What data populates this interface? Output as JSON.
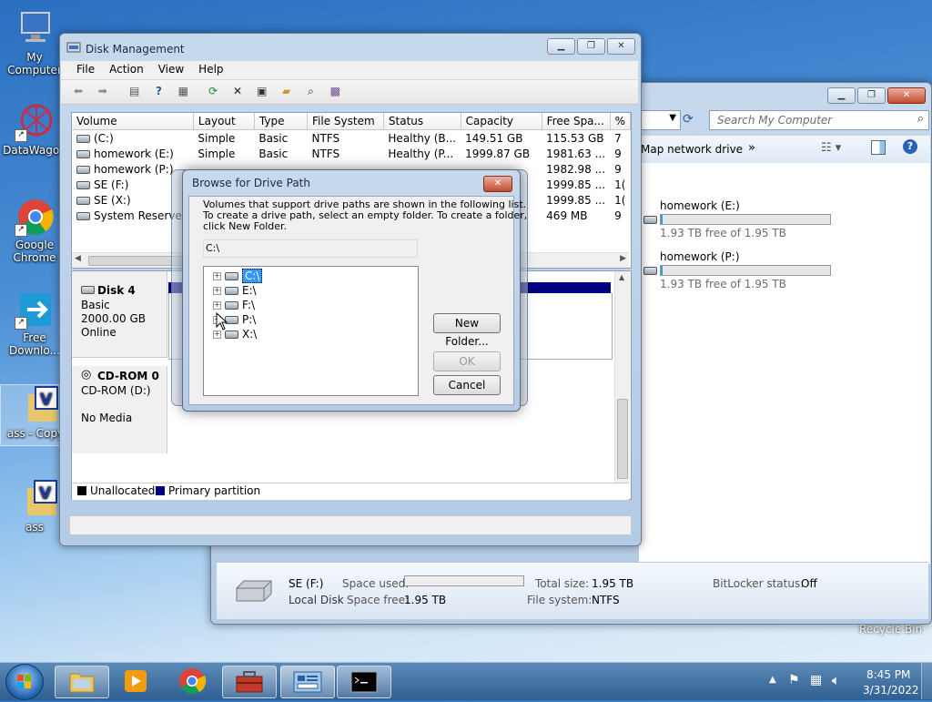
{
  "desktop": {
    "icons": [
      {
        "label": "My Computer",
        "glyph": "monitor-icon"
      },
      {
        "label": "DataWagon",
        "glyph": "datawagon-icon"
      },
      {
        "label": "Google Chrome",
        "glyph": "chrome-icon"
      },
      {
        "label": "Free Downlo...",
        "glyph": "download-icon"
      },
      {
        "label": "ass - Copy",
        "glyph": "folder-icon"
      },
      {
        "label": "ass",
        "glyph": "folder-icon"
      }
    ],
    "recycle_bin": "Recycle Bin"
  },
  "explorer": {
    "search_placeholder": "Search My Computer",
    "map_drive": "Map network drive",
    "more": "»",
    "drives": [
      {
        "name": "homework (E:)",
        "free": "1.93 TB free of 1.95 TB"
      },
      {
        "name": "homework (P:)",
        "free": "1.93 TB free of 1.95 TB"
      }
    ],
    "details": {
      "name": "SE (F:)",
      "type": "Local Disk",
      "space_used_label": "Space used:",
      "space_free_label": "Space free:",
      "space_free": "1.95 TB",
      "total_size_label": "Total size:",
      "total_size": "1.95 TB",
      "filesystem_label": "File system:",
      "filesystem": "NTFS",
      "bitlocker_label": "BitLocker status:",
      "bitlocker": "Off"
    }
  },
  "disk_mgmt": {
    "title": "Disk Management",
    "menu": [
      "File",
      "Action",
      "View",
      "Help"
    ],
    "columns": [
      "Volume",
      "Layout",
      "Type",
      "File System",
      "Status",
      "Capacity",
      "Free Spa...",
      "%"
    ],
    "rows": [
      [
        "(C:)",
        "Simple",
        "Basic",
        "NTFS",
        "Healthy (B...",
        "149.51 GB",
        "115.53 GB",
        "7"
      ],
      [
        "homework (E:)",
        "Simple",
        "Basic",
        "NTFS",
        "Healthy (P...",
        "1999.87 GB",
        "1981.63 ...",
        "9"
      ],
      [
        "homework (P:)",
        "",
        "",
        "",
        "",
        "",
        "1982.98 ...",
        "9"
      ],
      [
        "SE (F:)",
        "",
        "",
        "",
        "",
        "",
        "1999.85 ...",
        "1("
      ],
      [
        "SE (X:)",
        "",
        "",
        "",
        "",
        "",
        "1999.85 ...",
        "1("
      ],
      [
        "System Reserved",
        "",
        "",
        "",
        "",
        "",
        "469 MB",
        "9"
      ]
    ],
    "disk4": {
      "name": "Disk 4",
      "kind": "Basic",
      "size": "2000.00 GB",
      "state": "Online"
    },
    "cdrom": {
      "name": "CD-ROM 0",
      "drive": "CD-ROM (D:)",
      "media": "No Media"
    },
    "legend": {
      "unallocated": "Unallocated",
      "primary": "Primary partition"
    },
    "colors": {
      "unallocated": "#000000",
      "primary": "#000080"
    }
  },
  "dialog": {
    "title": "Browse for Drive Path",
    "desc1": "Volumes that support drive paths are shown in the following list.",
    "desc2": "To create a drive path, select an empty folder. To create a folder,",
    "desc3": "click New Folder.",
    "path": "C:\\",
    "tree": [
      "C:\\",
      "E:\\",
      "F:\\",
      "P:\\",
      "X:\\"
    ],
    "selected_index": 0,
    "new_folder": "New Folder...",
    "ok": "OK",
    "cancel": "Cancel"
  },
  "taskbar": {
    "time": "8:45 PM",
    "date": "3/31/2022"
  }
}
